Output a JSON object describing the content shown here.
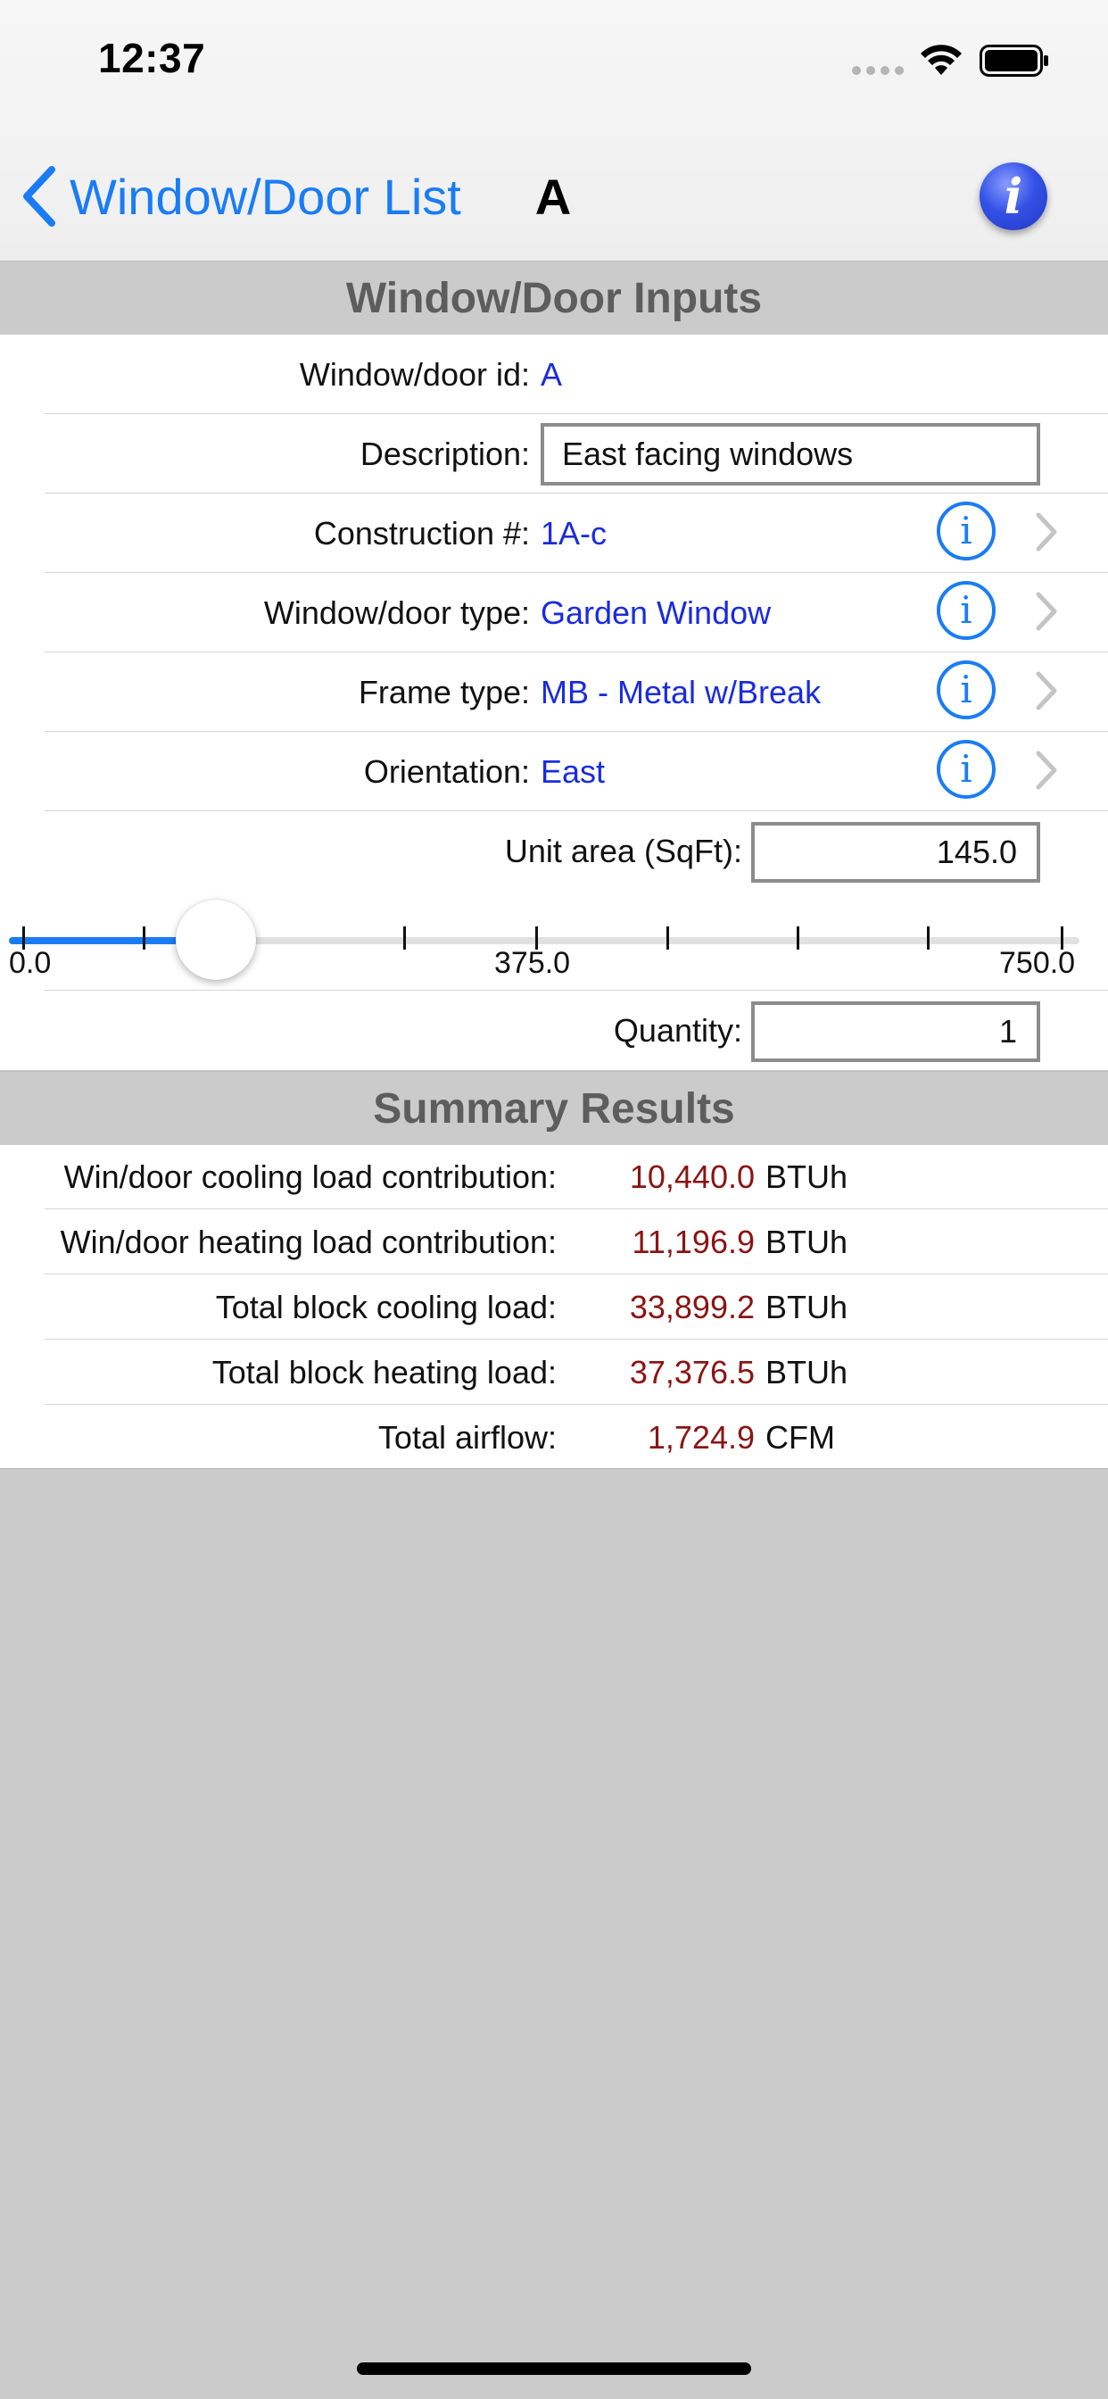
{
  "status_bar": {
    "time": "12:37"
  },
  "nav": {
    "back_label": "Window/Door List",
    "title": "A",
    "info_glyph": "i"
  },
  "inputs": {
    "section_title": "Window/Door Inputs",
    "id_label": "Window/door id:",
    "id_value": "A",
    "description_label": "Description:",
    "description_value": "East facing windows",
    "construction_label": "Construction #:",
    "construction_value": "1A-c",
    "type_label": "Window/door type:",
    "type_value": "Garden Window",
    "frame_label": "Frame type:",
    "frame_value": "MB - Metal w/Break",
    "orientation_label": "Orientation:",
    "orientation_value": "East",
    "unit_area_label": "Unit area (SqFt):",
    "unit_area_value": "145.0",
    "quantity_label": "Quantity:",
    "quantity_value": "1"
  },
  "slider": {
    "min_label": "0.0",
    "mid_label": "375.0",
    "max_label": "750.0",
    "min": 0,
    "max": 750,
    "value": 145
  },
  "summary": {
    "section_title": "Summary Results",
    "rows": [
      {
        "label": "Win/door cooling load contribution:",
        "value": "10,440.0",
        "unit": "BTUh"
      },
      {
        "label": "Win/door heating load contribution:",
        "value": "11,196.9",
        "unit": "BTUh"
      },
      {
        "label": "Total block cooling load:",
        "value": "33,899.2",
        "unit": "BTUh"
      },
      {
        "label": "Total block heating load:",
        "value": "37,376.5",
        "unit": "BTUh"
      },
      {
        "label": "Total airflow:",
        "value": "1,724.9",
        "unit": "CFM"
      }
    ]
  },
  "colors": {
    "accent": "#1a7cf5",
    "value_blue": "#1a2be0",
    "result_red": "#8b1414",
    "section_gray": "#cbcbcb"
  }
}
